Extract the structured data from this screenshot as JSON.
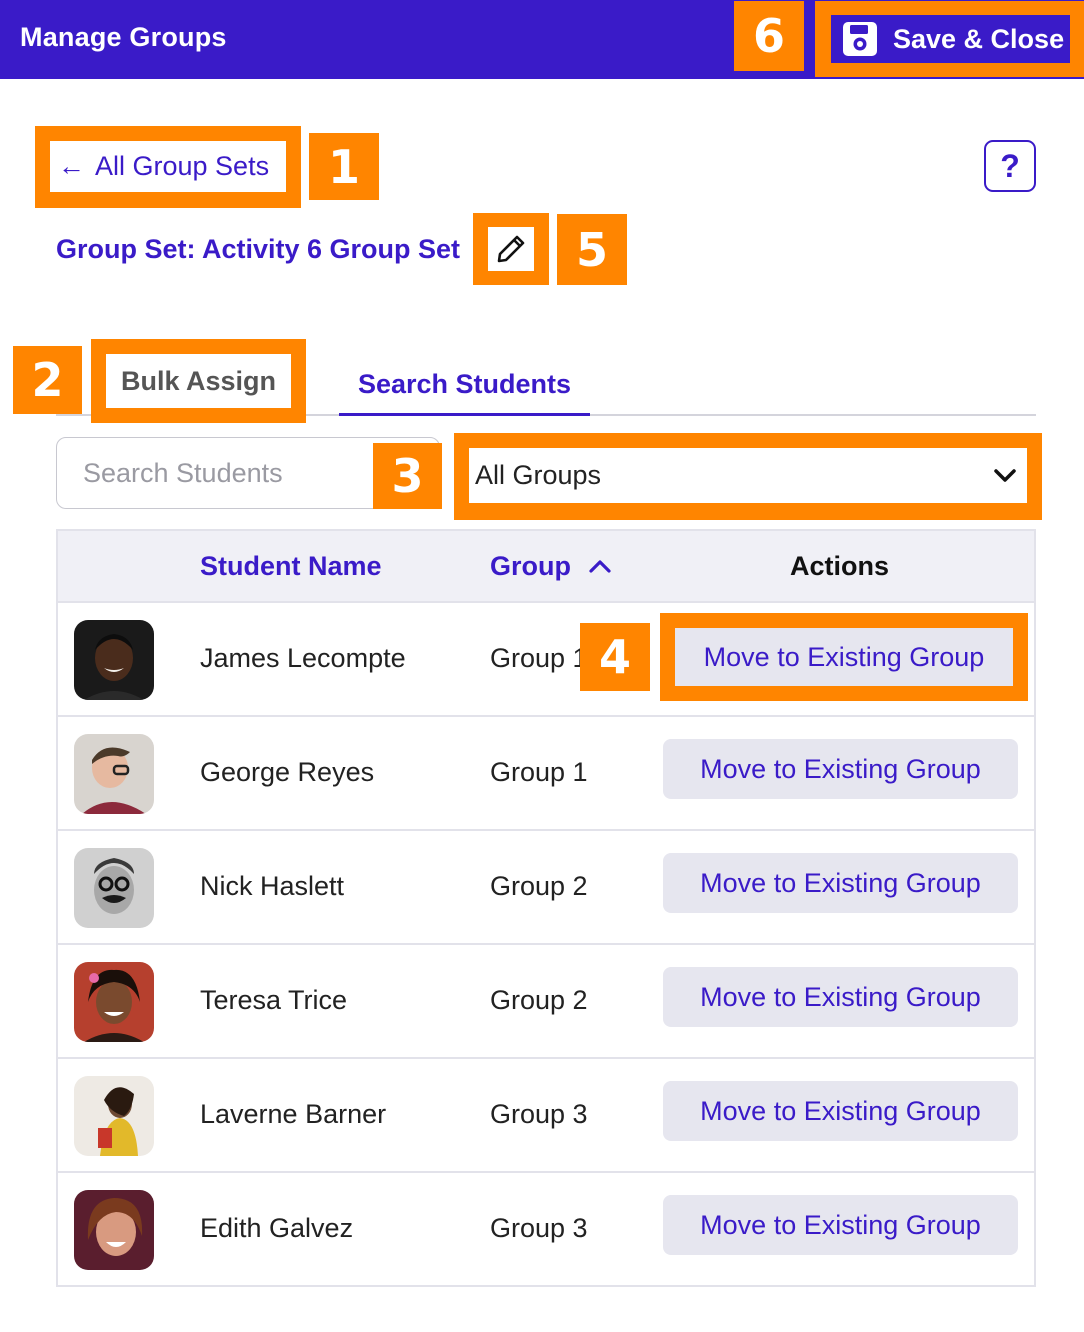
{
  "header": {
    "title": "Manage Groups",
    "save_label": "Save & Close",
    "save_icon": "floppy-disk-icon"
  },
  "nav": {
    "back_label": "All Group Sets",
    "back_icon": "arrow-left-icon",
    "help_label": "?"
  },
  "group_set": {
    "title": "Group Set: Activity 6 Group Set",
    "edit_icon": "pencil-icon"
  },
  "tabs": [
    {
      "label": "Bulk Assign",
      "active": false
    },
    {
      "label": "Search Students",
      "active": true
    }
  ],
  "filters": {
    "search_placeholder": "Search Students",
    "group_filter_value": "All Groups"
  },
  "table": {
    "columns": {
      "name": "Student Name",
      "group": "Group",
      "actions": "Actions"
    },
    "rows": [
      {
        "name": "James Lecompte",
        "group": "Group 1",
        "action": "Move to Existing Group"
      },
      {
        "name": "George Reyes",
        "group": "Group 1",
        "action": "Move to Existing Group"
      },
      {
        "name": "Nick Haslett",
        "group": "Group 2",
        "action": "Move to Existing Group"
      },
      {
        "name": "Teresa Trice",
        "group": "Group 2",
        "action": "Move to Existing Group"
      },
      {
        "name": "Laverne Barner",
        "group": "Group 3",
        "action": "Move to Existing Group"
      },
      {
        "name": "Edith Galvez",
        "group": "Group 3",
        "action": "Move to Existing Group"
      }
    ]
  },
  "callouts": [
    "1",
    "2",
    "3",
    "4",
    "5",
    "6"
  ],
  "colors": {
    "brand": "#3a1bc8",
    "callout": "#ff8500",
    "button_bg": "#e6e6ef",
    "header_row_bg": "#f0f0f6"
  }
}
